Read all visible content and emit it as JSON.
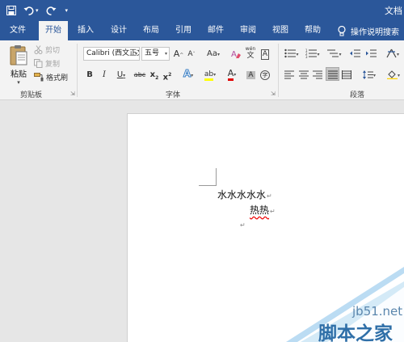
{
  "window": {
    "title": "文档"
  },
  "quick_access": {
    "undo_caret": "▾",
    "customize": "▾"
  },
  "tabs": [
    {
      "id": "file",
      "label": "文件"
    },
    {
      "id": "home",
      "label": "开始"
    },
    {
      "id": "insert",
      "label": "插入"
    },
    {
      "id": "design",
      "label": "设计"
    },
    {
      "id": "layout",
      "label": "布局"
    },
    {
      "id": "references",
      "label": "引用"
    },
    {
      "id": "mailings",
      "label": "邮件"
    },
    {
      "id": "review",
      "label": "审阅"
    },
    {
      "id": "view",
      "label": "视图"
    },
    {
      "id": "help",
      "label": "帮助"
    }
  ],
  "tell_me": {
    "label": "操作说明搜索"
  },
  "clipboard": {
    "group_label": "剪贴板",
    "paste": "粘贴",
    "cut": "剪切",
    "copy": "复制",
    "format_painter": "格式刷"
  },
  "font": {
    "group_label": "字体",
    "font_name": "Calibri (西文正文)",
    "font_size": "五号",
    "grow": "A",
    "shrink": "A",
    "change_case": "Aa",
    "phonetic": "wén",
    "phonetic_char": "文",
    "border_char": "A",
    "bold": "B",
    "italic": "I",
    "underline": "U",
    "strikethrough": "abc",
    "subscript": "x",
    "subscript_mark": "2",
    "superscript": "x",
    "superscript_mark": "2",
    "effects": "A",
    "highlight": "ab",
    "font_color": "A",
    "shading": "A",
    "enclose": "字"
  },
  "paragraph": {
    "group_label": "段落"
  },
  "document": {
    "line1": "水水水水水",
    "line2_prefix": "",
    "line2": "热热",
    "pilcrow": "↵"
  },
  "watermark": {
    "site": "jb51.net",
    "brand": "脚本之家"
  },
  "colors": {
    "title_bar": "#2b579a",
    "ribbon": "#f3f3f3",
    "workspace": "#e6e6e6",
    "font_color_bar": "#e00000",
    "highlight_bar": "#ffff00",
    "watermark_blue": "#2f6fa8"
  }
}
